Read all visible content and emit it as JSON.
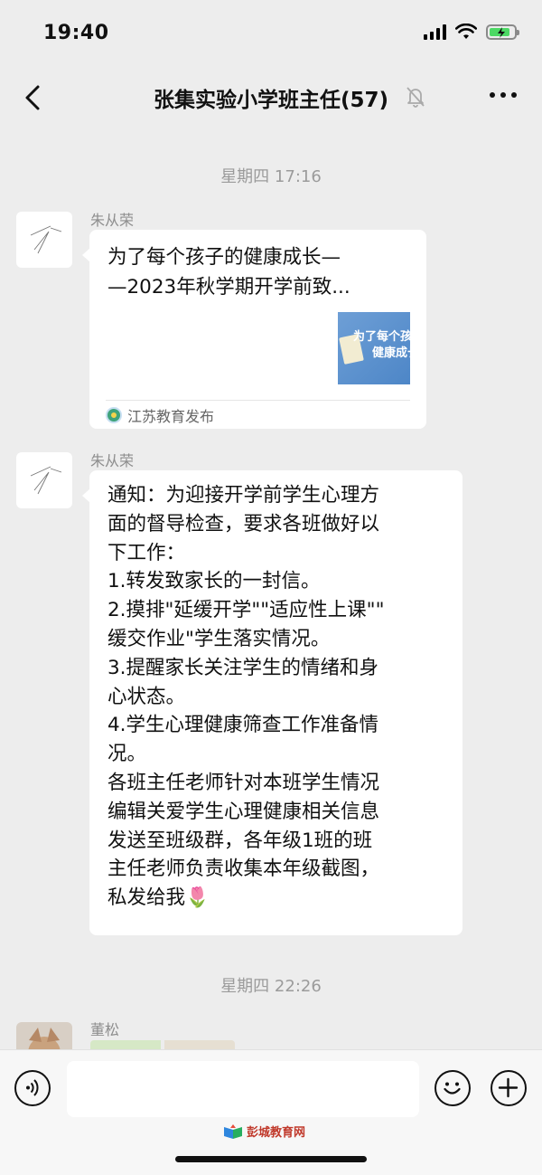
{
  "status": {
    "time": "19:40"
  },
  "nav": {
    "title": "张集实验小学班主任(57)"
  },
  "timestamps": [
    "星期四 17:16",
    "星期四 22:26"
  ],
  "messages": [
    {
      "sender": "朱从荣",
      "card": {
        "title": [
          "为了每个孩子的健康成长—",
          "—2023年秋学期开学前致..."
        ],
        "thumb_text": [
          "为了每个孩",
          "健康成长"
        ],
        "source": "江苏教育发布"
      }
    },
    {
      "sender": "朱从荣",
      "lines": [
        "通知：为迎接开学前学生心理方",
        "面的督导检查，要求各班做好以",
        "下工作：",
        "1.转发致家长的一封信。",
        "2.摸排\"延缓开学\"\"适应性上课\"\"",
        "缓交作业\"学生落实情况。",
        "3.提醒家长关注学生的情绪和身",
        "心状态。",
        "4.学生心理健康筛查工作准备情",
        "况。",
        "各班主任老师针对本班学生情况",
        "编辑关爱学生心理健康相关信息",
        "发送至班级群，各年级1班的班",
        "主任老师负责收集本年级截图，",
        "私发给我🌷"
      ]
    },
    {
      "sender": "董松"
    }
  ],
  "input": {
    "value": ""
  },
  "watermark": "彭城教育网",
  "icons": {
    "back": "chevron-left-icon",
    "mute": "bell-slash-icon",
    "more": "more-dots-icon",
    "voice": "voice-icon",
    "emoji": "emoji-icon",
    "add": "plus-icon"
  },
  "colors": {
    "background": "#ededed",
    "bubble": "#ffffff",
    "battery": "#4cd964"
  }
}
